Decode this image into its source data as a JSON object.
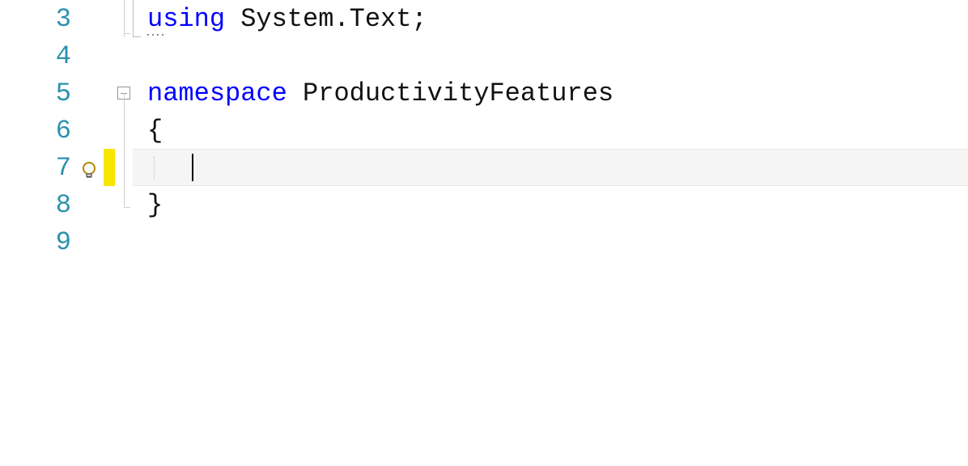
{
  "lines": {
    "l3": {
      "num": "3",
      "tokens": [
        {
          "t": "using",
          "c": "keyword"
        },
        {
          "t": " ",
          "c": "text"
        },
        {
          "t": "System.Text",
          "c": "type"
        },
        {
          "t": ";",
          "c": "punct"
        }
      ]
    },
    "l4": {
      "num": "4"
    },
    "l5": {
      "num": "5",
      "tokens": [
        {
          "t": "namespace",
          "c": "keyword"
        },
        {
          "t": " ",
          "c": "text"
        },
        {
          "t": "ProductivityFeatures",
          "c": "type"
        }
      ]
    },
    "l6": {
      "num": "6",
      "brace": "{"
    },
    "l7": {
      "num": "7"
    },
    "l8": {
      "num": "8",
      "brace": "}"
    },
    "l9": {
      "num": "9"
    }
  },
  "icons": {
    "lightbulb": "lightbulb-icon"
  }
}
